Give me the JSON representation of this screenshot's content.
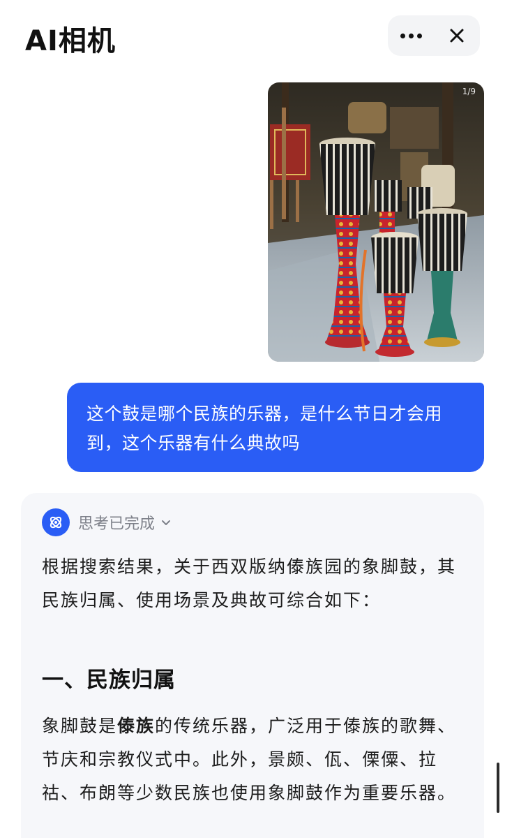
{
  "header": {
    "title": "AI相机",
    "more_icon": "more-dots-icon",
    "close_icon": "close-icon"
  },
  "photo": {
    "counter": "1/9",
    "subject": "drums-photo"
  },
  "user_message": {
    "text": "这个鼓是哪个民族的乐器，是什么节日才会用到，这个乐器有什么典故吗"
  },
  "answer": {
    "status": "思考已完成",
    "intro": "根据搜索结果，关于西双版纳傣族园的象脚鼓，其民族归属、使用场景及典故可综合如下：",
    "section1_title": "一、民族归属",
    "section1_pre": "象脚鼓是",
    "section1_bold": "傣族",
    "section1_post": "的传统乐器，广泛用于傣族的歌舞、节庆和宗教仪式中。此外，景颇、佤、傈僳、拉祜、布朗等少数民族也使用象脚鼓作为重要乐器。"
  },
  "colors": {
    "accent": "#2a5df5",
    "card_bg": "#f6f7fa",
    "muted_text": "#7d8089"
  }
}
